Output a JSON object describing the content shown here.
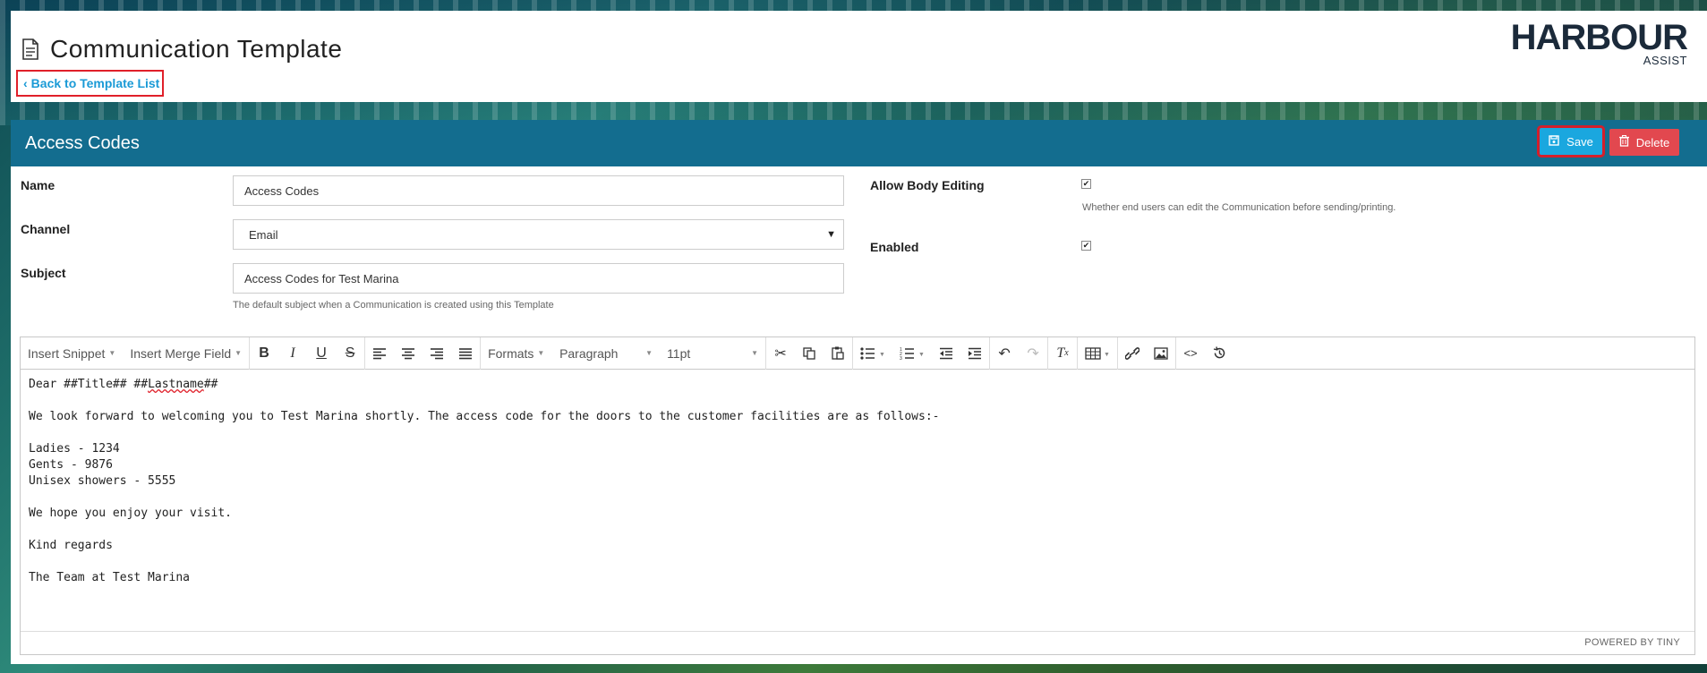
{
  "header": {
    "title": "Communication Template",
    "back_link": "Back to Template List",
    "logo_main": "HARBOUR",
    "logo_sub": "ASSIST"
  },
  "panel": {
    "title": "Access Codes",
    "save_label": "Save",
    "delete_label": "Delete"
  },
  "form": {
    "name_label": "Name",
    "name_value": "Access Codes",
    "channel_label": "Channel",
    "channel_value": "Email",
    "subject_label": "Subject",
    "subject_value": "Access Codes for Test Marina",
    "subject_help": "The default subject when a Communication is created using this Template",
    "allow_body_editing_label": "Allow Body Editing",
    "allow_body_editing_checked": true,
    "allow_body_editing_help": "Whether end users can edit the Communication before sending/printing.",
    "enabled_label": "Enabled",
    "enabled_checked": true
  },
  "editor": {
    "toolbar": {
      "insert_snippet": "Insert Snippet",
      "insert_merge_field": "Insert Merge Field",
      "formats": "Formats",
      "paragraph": "Paragraph",
      "font_size": "11pt"
    },
    "body": {
      "line1_prefix": "Dear ##Title## ##",
      "line1_spell": "Lastname",
      "line1_suffix": "##",
      "line2": "We look forward to welcoming you to Test Marina shortly.  The access code for the doors to the customer facilities are as follows:-",
      "line3": "Ladies - 1234",
      "line4": "Gents - 9876",
      "line5": "Unisex showers - 5555",
      "line6": "We hope you enjoy your visit.",
      "line7": "Kind regards",
      "line8": "The Team at Test Marina"
    },
    "status": "POWERED BY TINY"
  },
  "colors": {
    "panel_header": "#136d8f",
    "save": "#1aa7df",
    "delete": "#e2484f",
    "link": "#1a9ad6",
    "highlight": "#e0202a"
  }
}
